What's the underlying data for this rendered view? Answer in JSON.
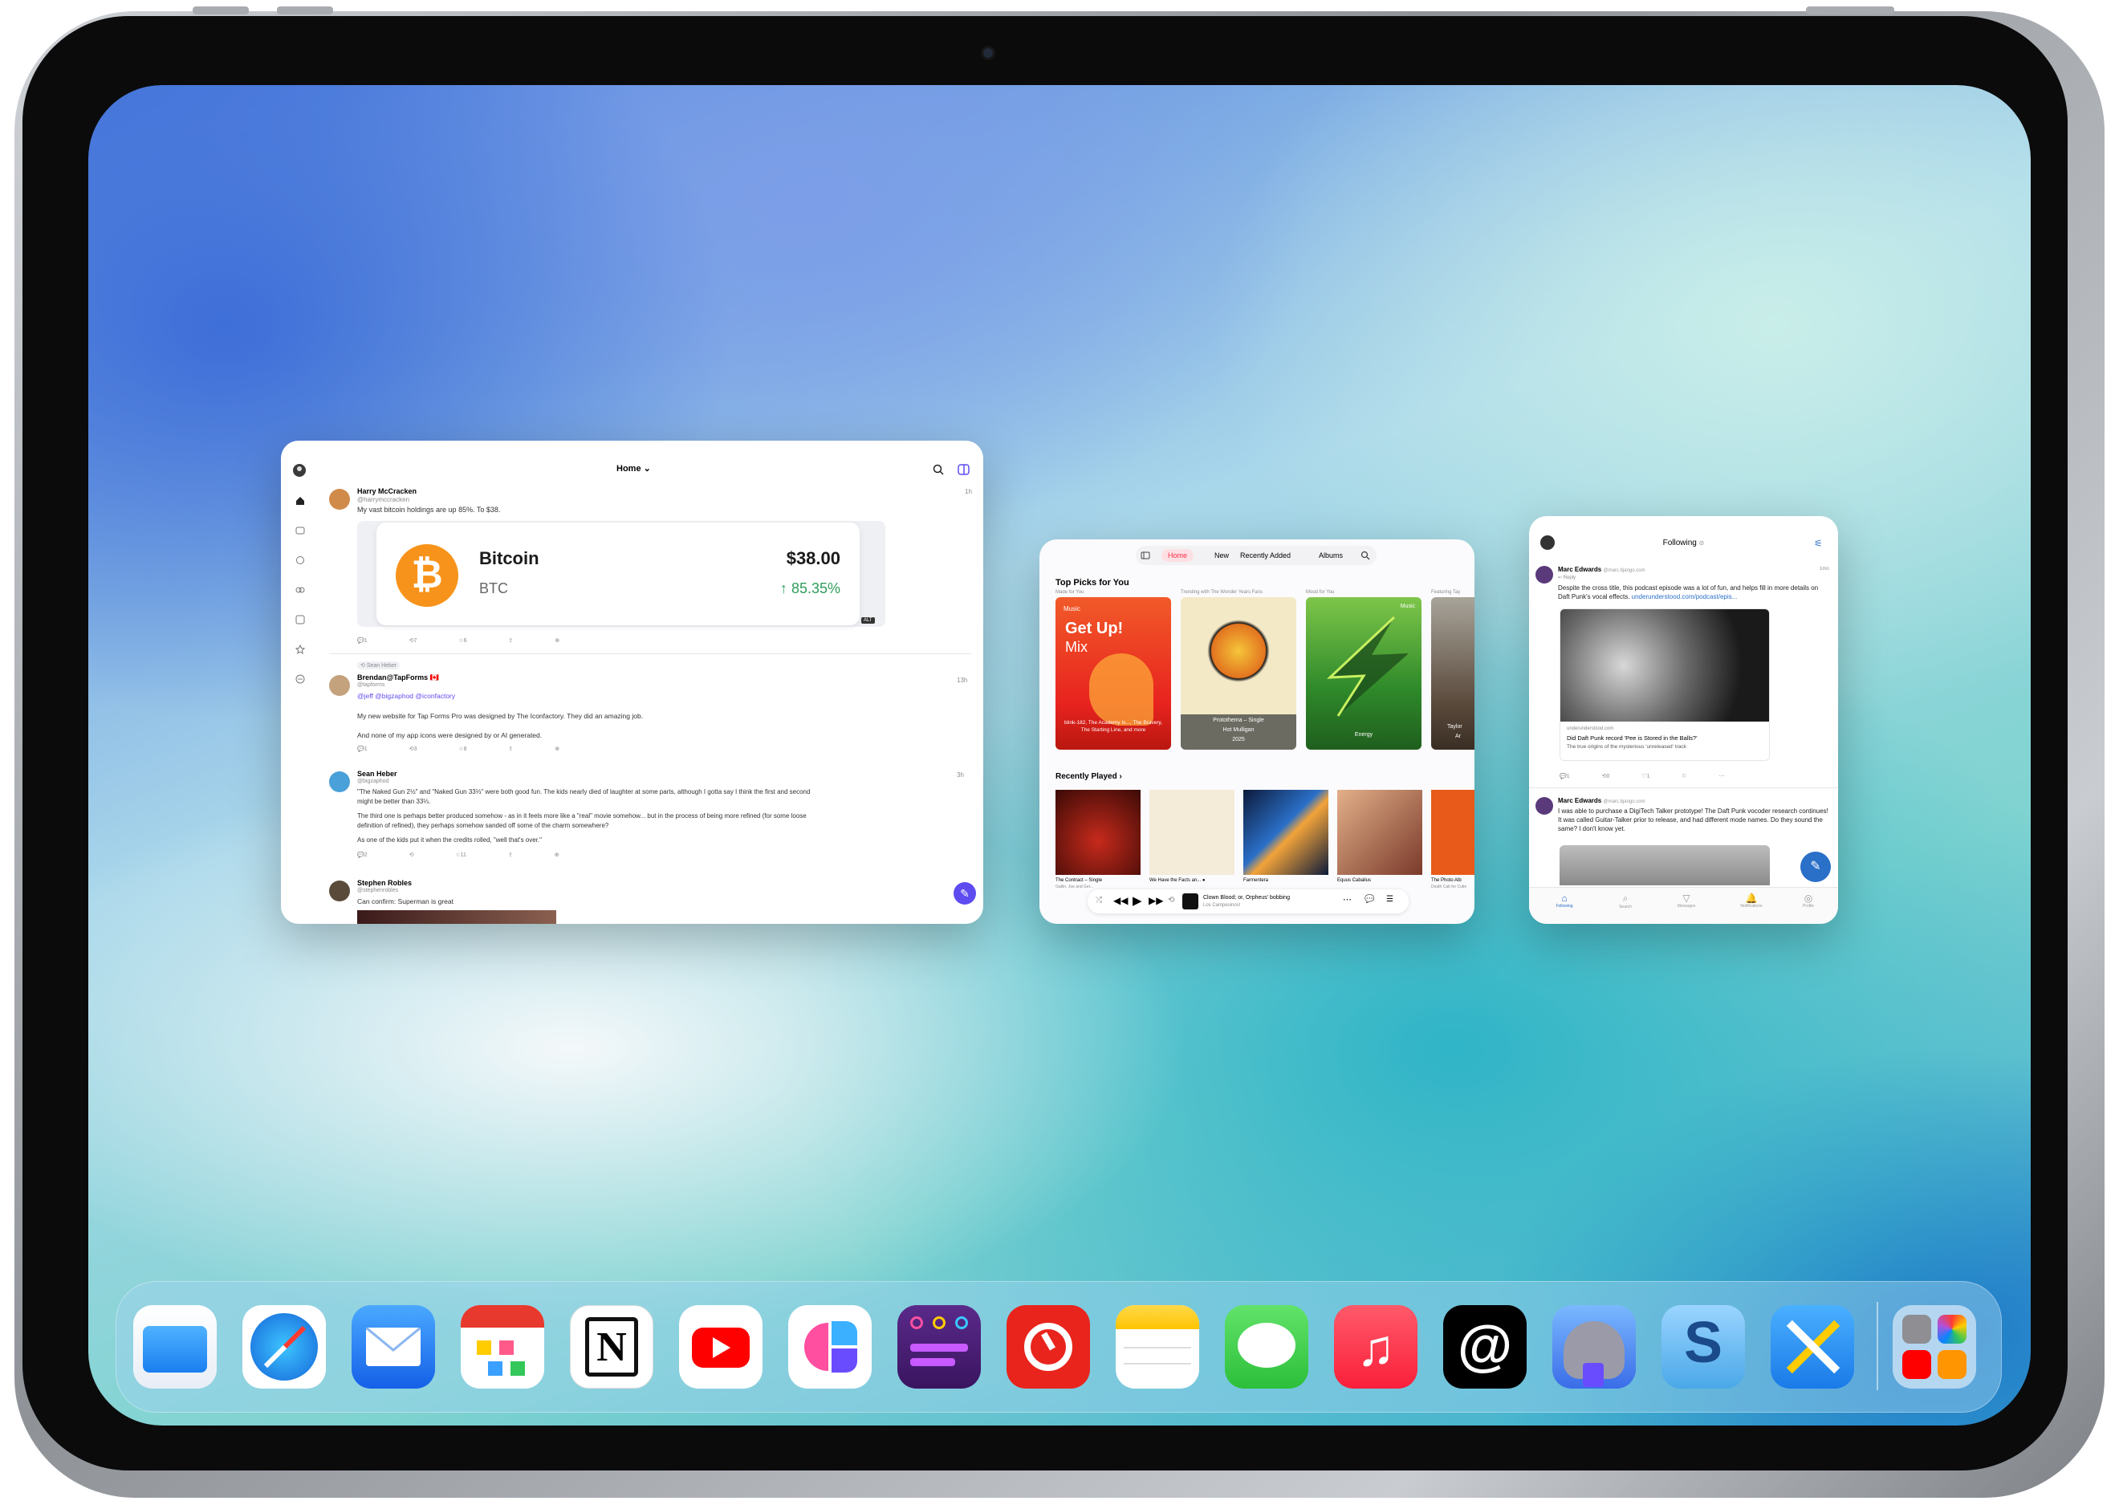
{
  "mastodon": {
    "nav_title": "Home",
    "posts": [
      {
        "name": "Harry McCracken",
        "handle": "@harrymccracken",
        "time": "1h",
        "text": "My vast bitcoin holdings are up 85%. To $38.",
        "counts": [
          "1",
          "7",
          "6"
        ]
      },
      {
        "boost": "Sean Heber",
        "name": "Brendan@TapForms 🇨🇦",
        "handle": "@tapforms",
        "time": "13h",
        "mentions": "@jeff @bigzaphod @iconfactory",
        "text1": "My new website for Tap Forms Pro was designed by The Iconfactory. They did an amazing job.",
        "text2": "And none of my app icons were designed by or AI generated.",
        "counts": [
          "1",
          "3",
          "8"
        ]
      },
      {
        "name": "Sean Heber",
        "handle": "@bigzaphod",
        "time": "3h",
        "text1": "\"The Naked Gun 2½\" and \"Naked Gun 33⅓\" were both good fun. The kids nearly died of laughter at some parts, although I gotta say I think the first and second",
        "text1b": "might be better than 33⅓.",
        "text2": "The third one is perhaps better produced somehow - as in it feels more like a \"real\" movie somehow... but in the process of being more refined (for some loose",
        "text2b": "definition of refined), they perhaps somehow sanded off some of the charm somewhere?",
        "text3": "As one of the kids put it when the credits rolled, \"well that's over.\"",
        "counts": [
          "2",
          "",
          "11"
        ]
      },
      {
        "name": "Stephen Robles",
        "handle": "@stephenrobles",
        "text": "Can confirm: Superman is great"
      }
    ],
    "card": {
      "title": "Bitcoin",
      "ticker": "BTC",
      "price": "$38.00",
      "change": "85.35%",
      "alt": "ALT"
    }
  },
  "music": {
    "tabs": [
      "Home",
      "New",
      "Recently Added",
      "Albums"
    ],
    "top_picks": "Top Picks for You",
    "sub": [
      "Made for You",
      "Trending with The Wonder Years Fans",
      "Mood for You",
      "Featuring Tay"
    ],
    "cards": [
      {
        "badge": "Music",
        "title": "Get Up!",
        "sub": "Mix",
        "caption": "blink-182, The Academy Is..., The Bravery, The Starting Line, and more"
      },
      {
        "caption": "Protothema – Single",
        "caption2": "Hot Mulligan",
        "caption3": "2025"
      },
      {
        "badge": "Music",
        "caption": "Energy"
      },
      {
        "caption": "Taylor",
        "caption2": "Ar"
      }
    ],
    "recent": "Recently Played",
    "recent_items": [
      {
        "t": "The Contract – Single",
        "s": "Gatlin, Joe and Gel..."
      },
      {
        "t": "We Have the Facts an... ●",
        "s": ""
      },
      {
        "t": "Farmentera",
        "s": ""
      },
      {
        "t": "Equus Caballus",
        "s": ""
      },
      {
        "t": "The Photo Alb",
        "s": "Death Cab for Cutie"
      }
    ],
    "now_playing": "Clown Blood; or, Orpheus' bobbing",
    "now_artist": "Los Campesinos!"
  },
  "ivory": {
    "title": "Following",
    "posts": [
      {
        "name": "Marc Edwards",
        "handle": "@marc.bjango.com",
        "time": "1mo",
        "reply": "Reply",
        "text": "Despite the cross title, this podcast episode was a lot of fun, and helps fill in more details on Daft Punk's vocal effects.",
        "link": "underunderstood.com/podcast/epis...",
        "card_domain": "underunderstood.com",
        "card_title": "Did Daft Punk record 'Pee is Stored in the Balls?'",
        "card_sub": "The true origins of the mysterious 'unreleased' track",
        "counts": [
          "1",
          "0",
          "1"
        ]
      },
      {
        "name": "Marc Edwards",
        "handle": "@marc.bjango.com",
        "text": "I was able to purchase a DigiTech Talker prototype! The Daft Punk vocoder research continues! It was called Guitar-Talker prior to release, and had different mode names. Do they sound the same? I don't know yet."
      }
    ],
    "tabs": [
      "Following",
      "Search",
      "Messages",
      "Notifications",
      "Profile"
    ]
  },
  "dock": [
    "Files",
    "Safari",
    "Mail",
    "Fantastical",
    "Notion",
    "YouTube",
    "Craft",
    "Taio",
    "Timery",
    "Notes",
    "Messages",
    "Music",
    "Threads",
    "Mastodon",
    "Scrobbles",
    "Toolbox",
    "App Library"
  ],
  "colors": {
    "bitcoin": "#f7931a",
    "gain": "#2e9d5a",
    "accent": "#5f4cf0",
    "music_red": "#fa2d48"
  }
}
